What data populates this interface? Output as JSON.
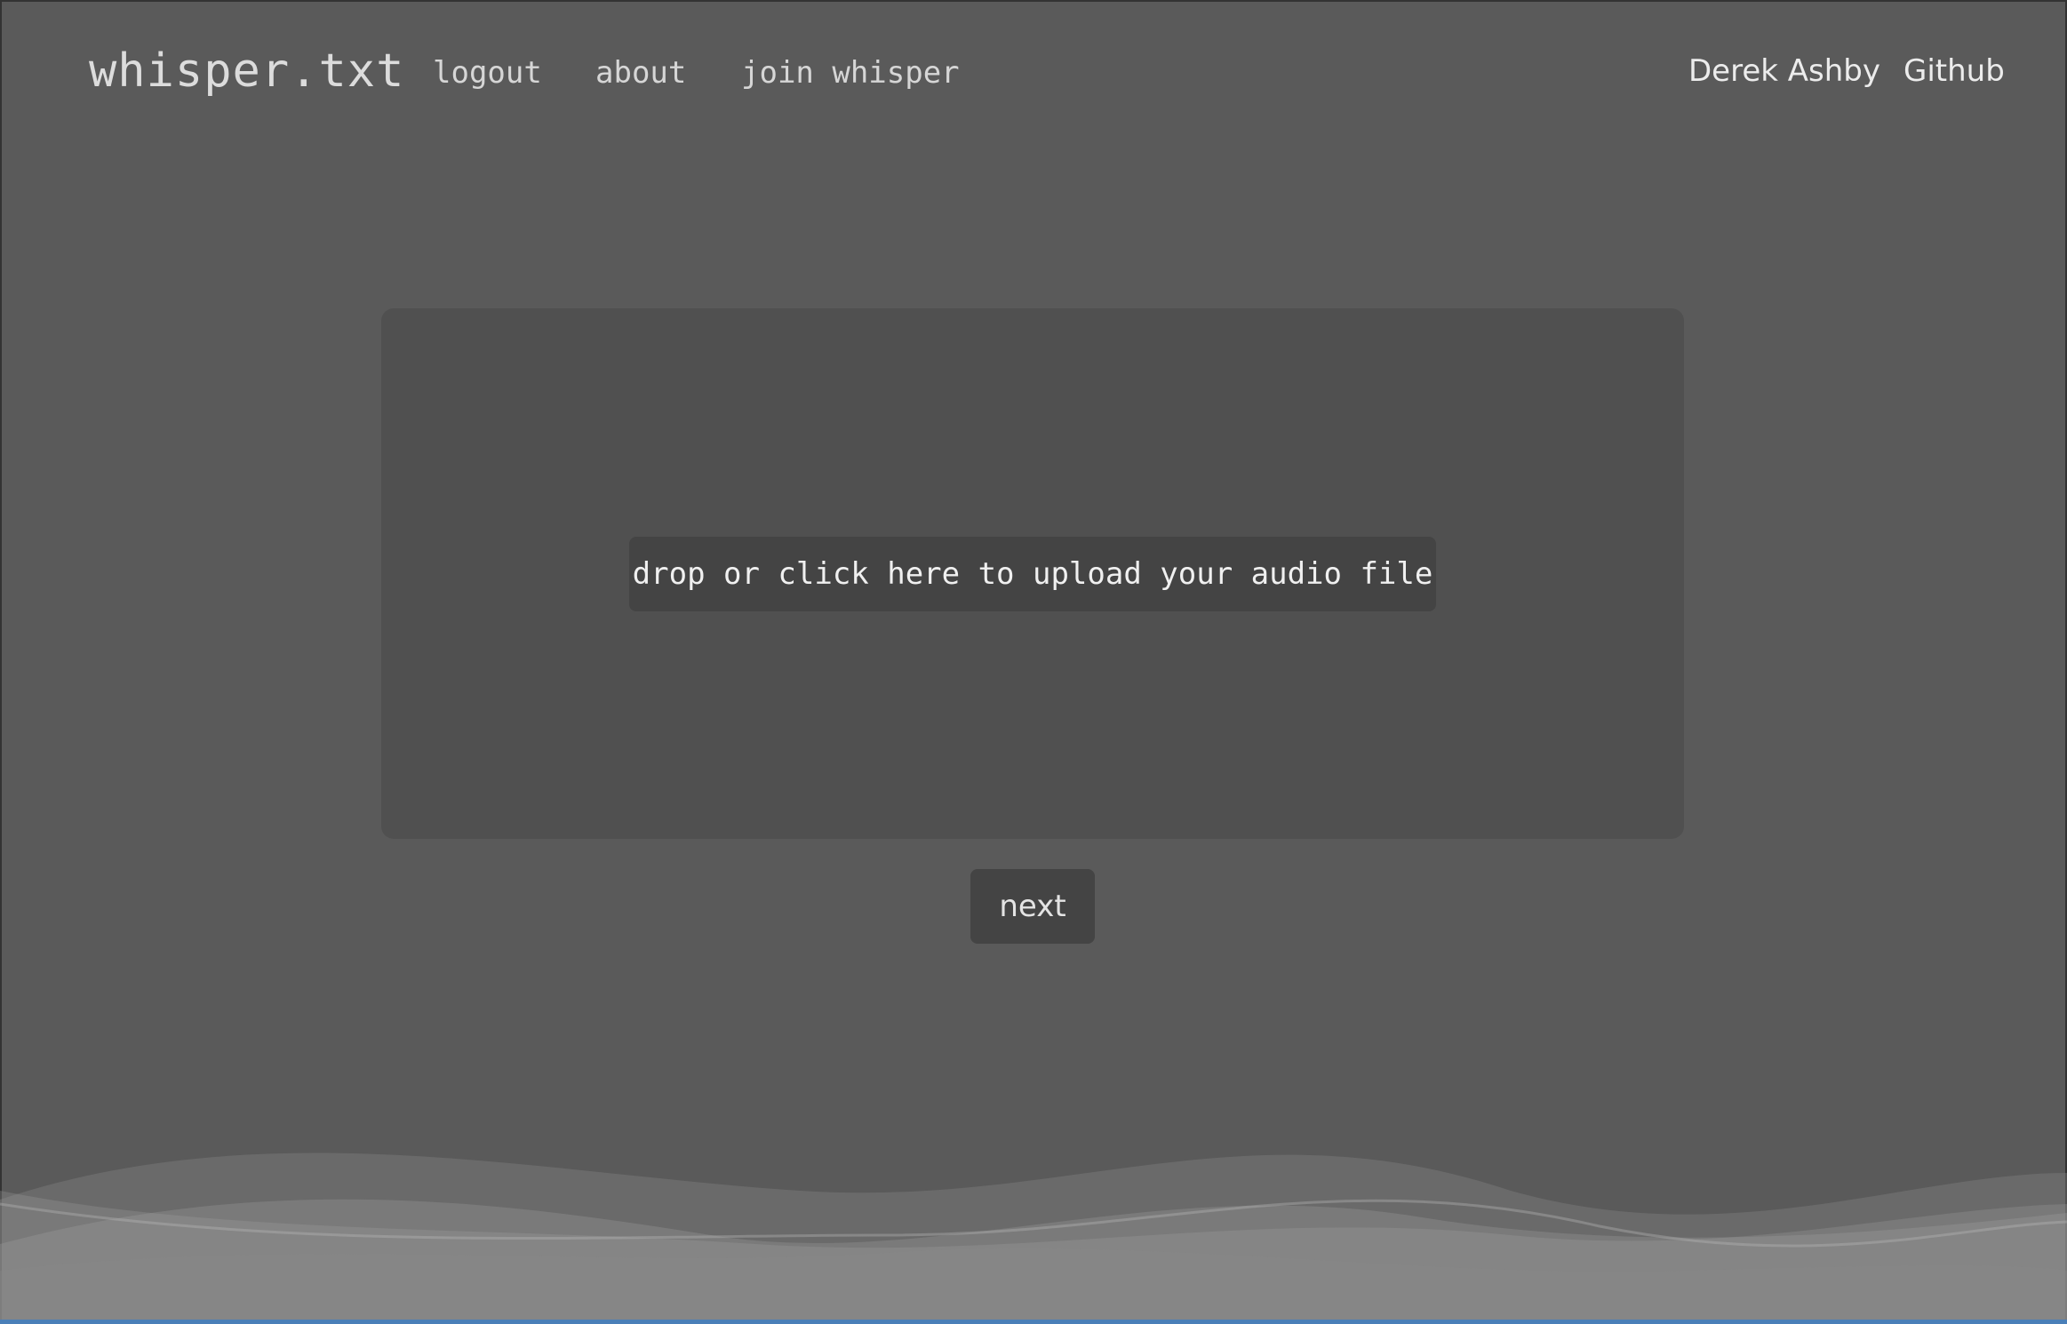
{
  "nav": {
    "brand": "whisper.txt",
    "links": [
      "logout",
      "about",
      "join whisper"
    ],
    "right_links": [
      "Derek Ashby",
      "Github"
    ]
  },
  "upload": {
    "label": "drop or click here to upload your audio file"
  },
  "actions": {
    "next_label": "next"
  },
  "colors": {
    "background": "#5a5a5a",
    "panel": "#505050",
    "button": "#444444",
    "text": "#e2e2e2",
    "wave": "#9a9a9a"
  }
}
